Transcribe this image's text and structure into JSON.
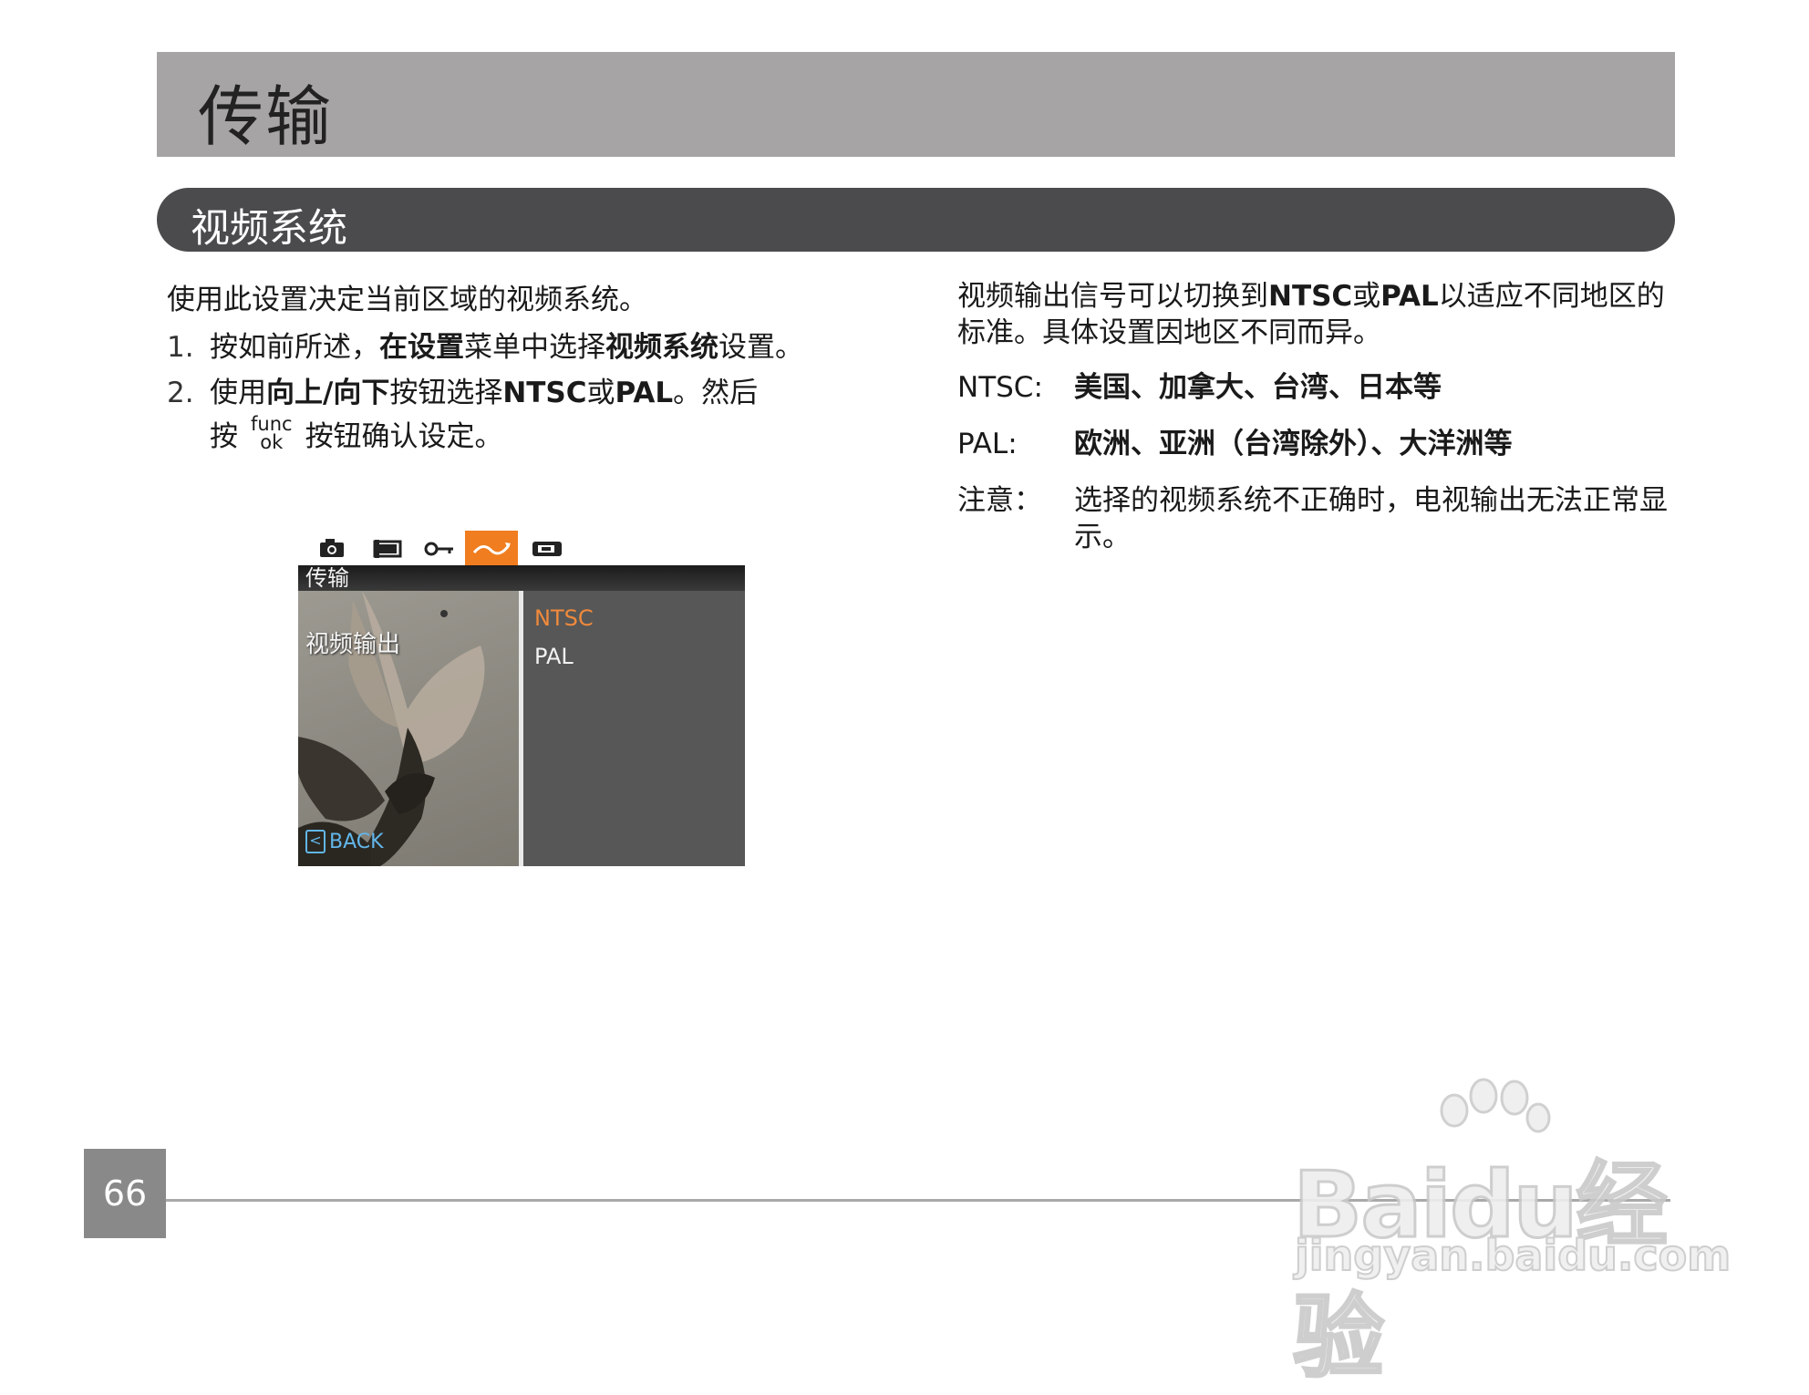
{
  "header": {
    "title": "传输"
  },
  "section": {
    "title": "视频系统"
  },
  "left": {
    "intro": "使用此设置决定当前区域的视频系统。",
    "step1": {
      "num": "1.",
      "t1": "按如前所述，",
      "b1": "在设置",
      "t2": "菜单中选择",
      "b2": "视频系统",
      "t3": "设置。"
    },
    "step2": {
      "num": "2.",
      "t1": "使用",
      "b1": "向上/向下",
      "t2": "按钮选择",
      "b2": "NTSC",
      "t3": "或",
      "b3": "PAL",
      "t4": "。然后",
      "t5": "按",
      "func": "func",
      "ok": "ok",
      "t6": "按钮确认设定。"
    }
  },
  "right": {
    "p1": {
      "t1": "视频输出信号可以切换到",
      "b1": "NTSC",
      "t2": "或",
      "b2": "PAL",
      "t3": "以适应不同地区的标准。具体设置因地区不同而异。"
    },
    "defs": [
      {
        "term": "NTSC:",
        "desc": "美国、加拿大、台湾、日本等"
      },
      {
        "term": "PAL:",
        "desc": "欧洲、亚洲（台湾除外）、大洋洲等"
      },
      {
        "term": "注意：",
        "desc": "选择的视频系统不正确时，电视输出无法正常显示。"
      }
    ]
  },
  "screen": {
    "tabs": [
      "camera-icon",
      "film-icon",
      "key-icon",
      "transfer-icon",
      "settings-icon"
    ],
    "active_tab": 3,
    "menu_title": "传输",
    "item_label": "视频输出",
    "options": [
      "NTSC",
      "PAL"
    ],
    "selected_option": 0,
    "back_label": "BACK",
    "accent_color": "#f07d1f",
    "back_color": "#62b6ea"
  },
  "footer": {
    "page_number": "66"
  },
  "watermark": {
    "logo": "Baidu经验",
    "url": "jingyan.baidu.com"
  }
}
